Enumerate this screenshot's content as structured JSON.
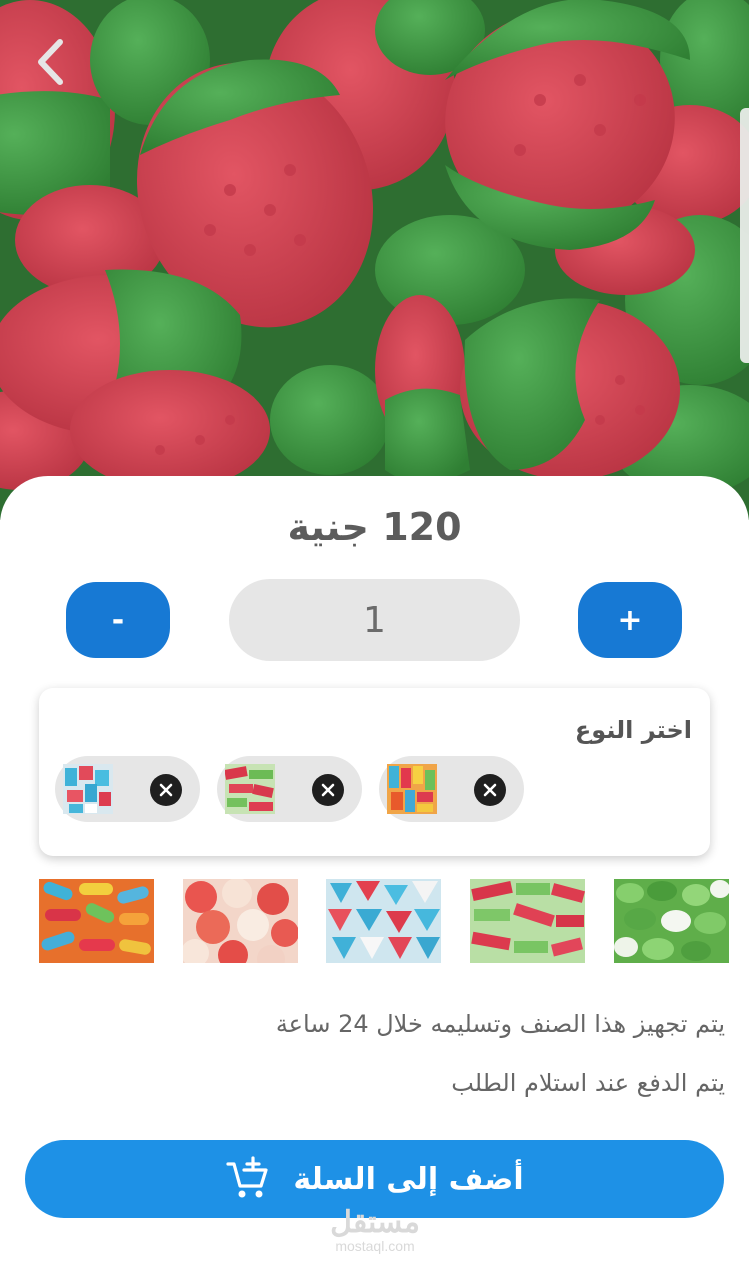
{
  "header": {
    "back_icon": "chevron-left-icon"
  },
  "product": {
    "price_amount": "120",
    "price_currency": "جنية",
    "quantity": "1",
    "increment_label": "+",
    "decrement_label": "-"
  },
  "type_selector": {
    "title": "اختر النوع",
    "selected": [
      {
        "name": "mixed-gummies"
      },
      {
        "name": "watermelon-gummies"
      },
      {
        "name": "blue-red-gummies"
      }
    ]
  },
  "gallery": {
    "items": [
      {
        "name": "green-leaf-gummies"
      },
      {
        "name": "watermelon-sour-sticks"
      },
      {
        "name": "blue-hearts-gummies"
      },
      {
        "name": "peach-rings-gummies"
      },
      {
        "name": "colorful-worms-gummies"
      }
    ]
  },
  "info": {
    "line1": "يتم تجهيز هذا الصنف وتسليمه خلال 24 ساعة",
    "line2": "يتم الدفع عند استلام الطلب"
  },
  "actions": {
    "add_to_cart": "أضف إلى السلة"
  },
  "watermark": {
    "arabic": "مستقل",
    "latin": "mostaql.com"
  },
  "colors": {
    "primary_button": "#1779d4",
    "cart_button": "#1e91e6",
    "chip_background": "#e6e6e6"
  }
}
